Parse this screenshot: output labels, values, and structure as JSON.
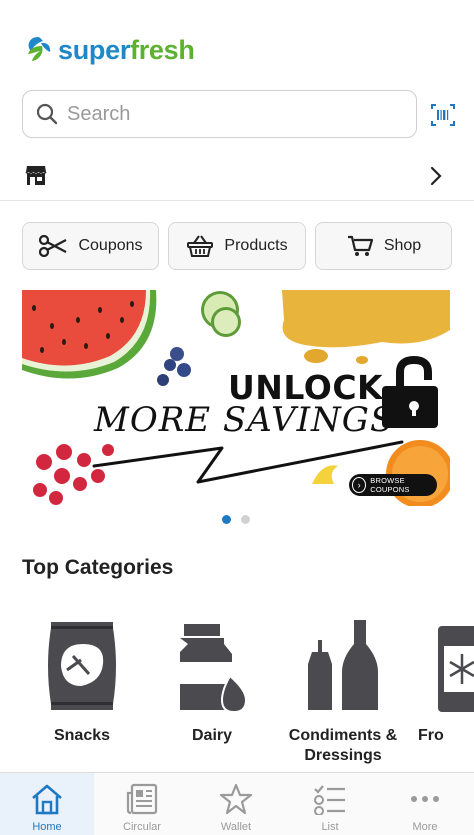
{
  "brand": {
    "logo_super": "super",
    "logo_fresh": "fresh",
    "blue": "#1E88C9",
    "green": "#5CB230"
  },
  "search": {
    "placeholder": "Search",
    "icon": "search-icon",
    "barcode_icon": "barcode-scan-icon"
  },
  "store": {
    "name": "",
    "icon": "storefront-icon"
  },
  "quick_actions": [
    {
      "label": "Coupons",
      "icon": "scissors-icon"
    },
    {
      "label": "Products",
      "icon": "basket-icon"
    },
    {
      "label": "Shop",
      "icon": "cart-icon"
    }
  ],
  "banner": {
    "headline_1": "UNLOCK",
    "headline_2": "MORE SAVINGS",
    "cta": "BROWSE COUPONS",
    "page_count": 2,
    "active_page": 1
  },
  "categories": {
    "title": "Top Categories",
    "items": [
      {
        "label": "Snacks",
        "icon": "snack-bag-icon"
      },
      {
        "label": "Dairy",
        "icon": "milk-carton-icon"
      },
      {
        "label": "Condiments & Dressings",
        "icon": "condiment-bottles-icon"
      },
      {
        "label": "Fro",
        "icon": "freezer-icon"
      }
    ]
  },
  "tabs": [
    {
      "label": "Home",
      "icon": "home-icon",
      "active": true
    },
    {
      "label": "Circular",
      "icon": "newspaper-icon",
      "active": false
    },
    {
      "label": "Wallet",
      "icon": "star-icon",
      "active": false
    },
    {
      "label": "List",
      "icon": "checklist-icon",
      "active": false
    },
    {
      "label": "More",
      "icon": "more-dots-icon",
      "active": false
    }
  ],
  "colors": {
    "accent": "#1E78C2",
    "icon_gray": "#4a4a4f"
  }
}
